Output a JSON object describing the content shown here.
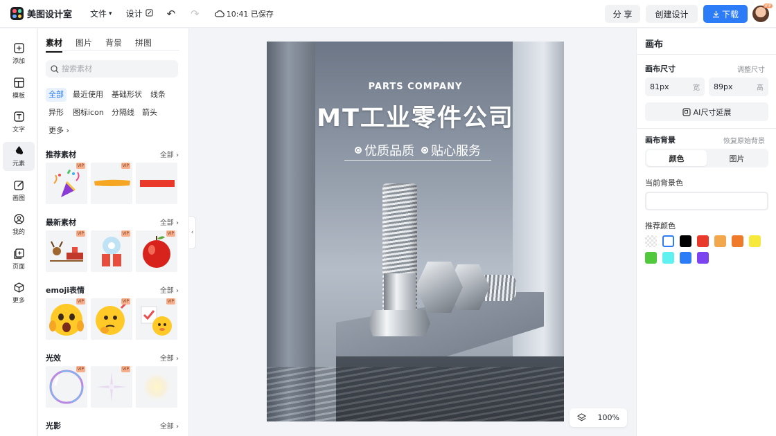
{
  "app": {
    "name": "美图设计室"
  },
  "topbar": {
    "file_label": "文件",
    "design_label": "设计",
    "saved_text": "10:41 已保存",
    "share_label": "分 享",
    "create_label": "创建设计",
    "download_label": "下载",
    "avatar_vip": "VIP"
  },
  "rail": {
    "items": [
      {
        "label": "添加",
        "icon": "plus-square-icon"
      },
      {
        "label": "模板",
        "icon": "template-icon"
      },
      {
        "label": "文字",
        "icon": "text-icon"
      },
      {
        "label": "元素",
        "icon": "element-icon"
      },
      {
        "label": "画图",
        "icon": "draw-icon"
      },
      {
        "label": "我的",
        "icon": "user-icon"
      },
      {
        "label": "页面",
        "icon": "page-icon"
      },
      {
        "label": "更多",
        "icon": "cube-icon"
      }
    ]
  },
  "panel": {
    "tabs": [
      "素材",
      "图片",
      "背景",
      "拼图"
    ],
    "search_placeholder": "搜索素材",
    "chips": [
      "全部",
      "最近使用",
      "基础形状",
      "线条",
      "异形",
      "图标icon",
      "分隔线",
      "箭头",
      "更多"
    ],
    "all_label": "全部",
    "vip": "VIP",
    "sections": [
      "推荐素材",
      "最新素材",
      "emoji表情",
      "光效",
      "光影"
    ]
  },
  "poster": {
    "subtitle": "PARTS COMPANY",
    "title": "MT工业零件公司",
    "tag1": "优质品质",
    "tag2": "贴心服务"
  },
  "canvas": {
    "zoom": "100%"
  },
  "rpanel": {
    "title": "画布",
    "size_label": "画布尺寸",
    "resize_link": "调整尺寸",
    "width_value": "81px",
    "width_unit": "宽",
    "height_value": "89px",
    "height_unit": "高",
    "ai_extend": "AI尺寸延展",
    "bg_label": "画布背景",
    "restore_bg": "恢复原始背景",
    "seg_color": "颜色",
    "seg_image": "图片",
    "current_bg": "当前背景色",
    "recommend_colors": "推荐颜色",
    "swatches": [
      "transparent",
      "#ffffff",
      "#000000",
      "#e8392b",
      "#f3a74d",
      "#ee7a2a",
      "#f7e93c",
      "#52c93c",
      "#5ff0f0",
      "#2b7cf6",
      "#7c44f0"
    ]
  },
  "colors": {
    "accent": "#2b7cf6"
  }
}
